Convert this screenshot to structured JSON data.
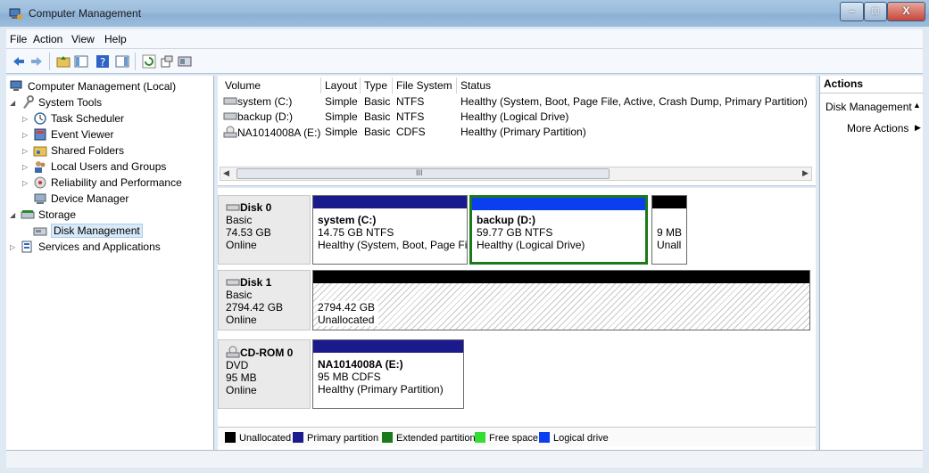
{
  "window": {
    "title": "Computer Management"
  },
  "menu": [
    "File",
    "Action",
    "View",
    "Help"
  ],
  "tree": {
    "root": "Computer Management (Local)",
    "system_tools": "System Tools",
    "task_scheduler": "Task Scheduler",
    "event_viewer": "Event Viewer",
    "shared_folders": "Shared Folders",
    "local_users": "Local Users and Groups",
    "reliability": "Reliability and Performance",
    "device_manager": "Device Manager",
    "storage": "Storage",
    "disk_management": "Disk Management",
    "services": "Services and Applications"
  },
  "volumes": {
    "columns": [
      "Volume",
      "Layout",
      "Type",
      "File System",
      "Status"
    ],
    "rows": [
      [
        "system (C:)",
        "Simple",
        "Basic",
        "NTFS",
        "Healthy (System, Boot, Page File, Active, Crash Dump, Primary Partition)"
      ],
      [
        "backup (D:)",
        "Simple",
        "Basic",
        "NTFS",
        "Healthy (Logical Drive)"
      ],
      [
        "NA1014008A (E:)",
        "Simple",
        "Basic",
        "CDFS",
        "Healthy (Primary Partition)"
      ]
    ],
    "scroll_grip": "III"
  },
  "disks": {
    "disk0": {
      "name": "Disk 0",
      "type": "Basic",
      "size": "74.53 GB",
      "status": "Online",
      "p1_name": "system (C:)",
      "p1_size": "14.75 GB NTFS",
      "p1_status": "Healthy (System, Boot, Page Fi",
      "p2_name": "backup (D:)",
      "p2_size": "59.77 GB NTFS",
      "p2_status": "Healthy (Logical Drive)",
      "p3_size": "9 MB",
      "p3_status": "Unall"
    },
    "disk1": {
      "name": "Disk 1",
      "type": "Basic",
      "size": "2794.42 GB",
      "status": "Online",
      "p1_size": "2794.42 GB",
      "p1_status": "Unallocated"
    },
    "cdrom0": {
      "name": "CD-ROM 0",
      "type": "DVD",
      "size": "95 MB",
      "status": "Online",
      "p1_name": "NA1014008A (E:)",
      "p1_size": "95 MB CDFS",
      "p1_status": "Healthy (Primary Partition)"
    }
  },
  "legend": [
    {
      "label": "Unallocated",
      "color": "#000000"
    },
    {
      "label": "Primary partition",
      "color": "#1a1a8c"
    },
    {
      "label": "Extended partition",
      "color": "#1a7a1a"
    },
    {
      "label": "Free space",
      "color": "#33dd33"
    },
    {
      "label": "Logical drive",
      "color": "#0a3ef0"
    }
  ],
  "actions": {
    "header": "Actions",
    "item1": "Disk Management",
    "item2": "More Actions"
  }
}
